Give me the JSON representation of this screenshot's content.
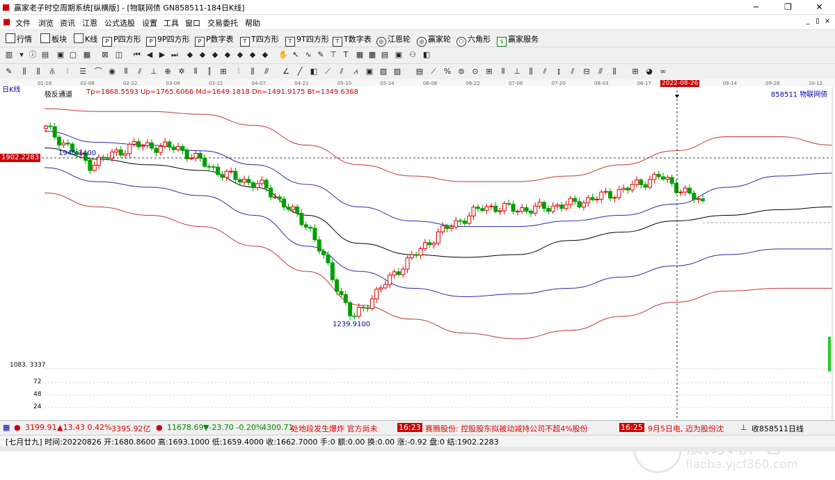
{
  "window": {
    "title": "赢家老子时空周期系统[纵横版] - [物联网债  GN858511-184日K线]",
    "controls": [
      "─",
      "❐",
      "✕"
    ]
  },
  "menu": {
    "items": [
      "文件",
      "浏览",
      "资讯",
      "江恩",
      "公式选股",
      "设置",
      "工具",
      "窗口",
      "交易委托",
      "帮助"
    ],
    "right_buttons": [
      "_",
      "▯",
      "×"
    ]
  },
  "toolbar1": {
    "items": [
      {
        "icon": "grid-icon",
        "label": "行情"
      },
      {
        "icon": "blocks-icon",
        "label": "板块"
      },
      {
        "icon": "candle-icon",
        "label": "K线"
      },
      {
        "icon": "p-square-icon",
        "label": "P四方形"
      },
      {
        "icon": "p9-square-icon",
        "label": "9P四方形"
      },
      {
        "icon": "p-number-icon",
        "label": "P数字表"
      },
      {
        "icon": "t-square-icon",
        "label": "T四方形"
      },
      {
        "icon": "t9-square-icon",
        "label": "9T四方形"
      },
      {
        "icon": "t-number-icon",
        "label": "T数字表"
      },
      {
        "icon": "jiangen-wheel-icon",
        "label": "江恩轮"
      },
      {
        "icon": "yingjia-wheel-icon",
        "label": "赢家轮"
      },
      {
        "icon": "hexagon-icon",
        "label": "六角形"
      },
      {
        "icon": "service-icon",
        "label": "赢家服务"
      }
    ]
  },
  "chart": {
    "period_label": "日K线",
    "indicator_name": "极反通道",
    "indicator_values": "Tp=1868.5593  Up=1765.6066  Md=1649.1818  Dn=1491.9175  Bt=1349.6368",
    "security": "858511  物联网债",
    "date_ticks": [
      "01-18",
      "02-08",
      "02-22",
      "03-08",
      "03-22",
      "04-07",
      "04-21",
      "05-10",
      "05-24",
      "06-08",
      "06-22",
      "07-06",
      "07-20",
      "08-03",
      "08-17",
      "08-26",
      "09-14",
      "09-28",
      "10-12"
    ],
    "cursor_date": "2022-08-26",
    "cursor_price_label": "1902.2283",
    "high_annotation": "1945.1400",
    "low_annotation": "1239.9100",
    "lower_axis_label": "1083. 3337",
    "volume_ticks": [
      "72",
      "48",
      "24"
    ],
    "colors": {
      "up": "#e00000",
      "down": "#00a000",
      "tp": "#c83232",
      "up_line": "#2828b4",
      "md": "#000000"
    }
  },
  "chart_data": {
    "type": "candlestick",
    "ylim": [
      1083.3337,
      2060
    ],
    "x": [
      "01-18",
      "02-08",
      "02-22",
      "03-08",
      "03-22",
      "04-07",
      "04-21",
      "05-10",
      "05-24",
      "06-08",
      "06-22",
      "07-06",
      "07-20",
      "08-03",
      "08-17",
      "08-26"
    ],
    "close": [
      1930,
      1800,
      1870,
      1860,
      1770,
      1720,
      1580,
      1250,
      1420,
      1560,
      1650,
      1640,
      1660,
      1700,
      1760,
      1663
    ],
    "channels": {
      "Tp": [
        2000,
        1990,
        1990,
        1980,
        1940,
        1870,
        1800,
        1760,
        1740,
        1740,
        1760,
        1800,
        1850,
        1900,
        1900,
        1870
      ],
      "Up": [
        1920,
        1880,
        1870,
        1850,
        1800,
        1730,
        1650,
        1600,
        1580,
        1580,
        1600,
        1620,
        1660,
        1720,
        1760,
        1770
      ],
      "Md": [
        1860,
        1820,
        1800,
        1780,
        1720,
        1620,
        1520,
        1480,
        1470,
        1480,
        1530,
        1560,
        1600,
        1620,
        1640,
        1650
      ],
      "Dn": [
        1790,
        1740,
        1720,
        1690,
        1620,
        1510,
        1420,
        1360,
        1330,
        1340,
        1360,
        1400,
        1440,
        1480,
        1500,
        1500
      ],
      "Bt": [
        1700,
        1650,
        1620,
        1580,
        1510,
        1420,
        1300,
        1250,
        1200,
        1180,
        1210,
        1260,
        1310,
        1350,
        1360,
        1360
      ]
    }
  },
  "status": {
    "sh_index": "3199.91",
    "sh_change": "▲13.43 0.42%",
    "sh_amount": "3395.92亿",
    "sz_index": "11678.69",
    "sz_change": "▼-23.70 -0.20%",
    "sz_amount": "4300.71",
    "news1": "处地段发生爆炸 官方尚未",
    "time1": "16:23",
    "news2": "赛腾股份: 控股股东拟被动减持公司不超4%股份",
    "time2": "16:25",
    "news3": "9月5日电, 迈为股份沈",
    "security_label": "收858511日线"
  },
  "infobar": {
    "text": "[七月廿九] 时间:20220826 开:1680.8600 高:1693.1000 低:1659.4000 收:1662.7000 手:0 额:0.00 换:0.00 涨:-0.92 盘:0 结:1902.2283"
  },
  "watermark": {
    "title": "赢家聊吧",
    "url": "liaoba.yjcf360.com"
  }
}
